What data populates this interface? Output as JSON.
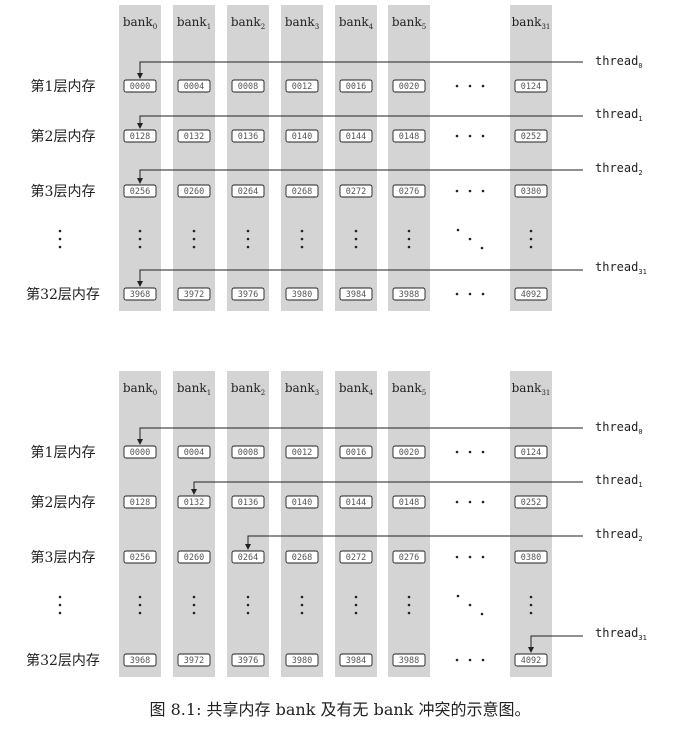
{
  "banks": [
    {
      "base": "bank",
      "sub": "0"
    },
    {
      "base": "bank",
      "sub": "1"
    },
    {
      "base": "bank",
      "sub": "2"
    },
    {
      "base": "bank",
      "sub": "3"
    },
    {
      "base": "bank",
      "sub": "4"
    },
    {
      "base": "bank",
      "sub": "5"
    },
    {
      "base": "bank",
      "sub": "31"
    }
  ],
  "rows": [
    {
      "label": "第1层内存",
      "addresses": [
        "0000",
        "0004",
        "0008",
        "0012",
        "0016",
        "0020",
        "0124"
      ]
    },
    {
      "label": "第2层内存",
      "addresses": [
        "0128",
        "0132",
        "0136",
        "0140",
        "0144",
        "0148",
        "0252"
      ]
    },
    {
      "label": "第3层内存",
      "addresses": [
        "0256",
        "0260",
        "0264",
        "0268",
        "0272",
        "0276",
        "0380"
      ]
    },
    {
      "label": "第32层内存",
      "addresses": [
        "3968",
        "3972",
        "3976",
        "3980",
        "3984",
        "3988",
        "4092"
      ]
    }
  ],
  "threads": [
    {
      "base": "thread",
      "sub": "0"
    },
    {
      "base": "thread",
      "sub": "1"
    },
    {
      "base": "thread",
      "sub": "2"
    },
    {
      "base": "thread",
      "sub": "31"
    }
  ],
  "panels": [
    {
      "name": "with-bank-conflict",
      "targets": [
        0,
        0,
        0,
        0
      ]
    },
    {
      "name": "without-bank-conflict",
      "targets": [
        0,
        1,
        2,
        6
      ]
    }
  ],
  "caption": "图 8.1: 共享内存 bank 及有无 bank 冲突的示意图。",
  "colors": {
    "column": "#d4d4d4",
    "line": "#222222",
    "cell_text": "#555555",
    "label": "#222222"
  }
}
